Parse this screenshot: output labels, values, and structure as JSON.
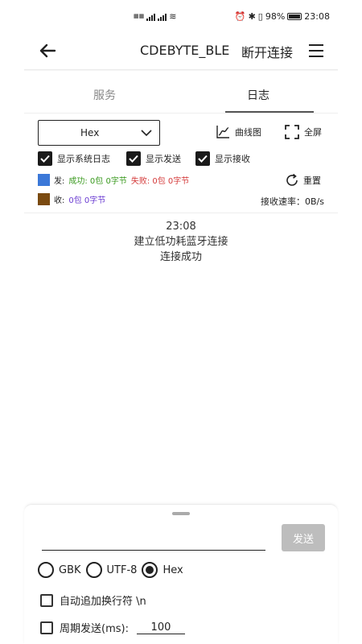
{
  "status_bar": {
    "battery_text": "98%",
    "time": "23:08"
  },
  "title_bar": {
    "title": "CDEBYTE_BLE",
    "disconnect_label": "断开连接"
  },
  "tabs": [
    {
      "label": "服务",
      "active": false
    },
    {
      "label": "日志",
      "active": true
    }
  ],
  "controls": {
    "encoding_select": "Hex",
    "chart_label": "曲线图",
    "fullscreen_label": "全屏"
  },
  "checkboxes": [
    {
      "label": "显示系统日志",
      "checked": true
    },
    {
      "label": "显示发送",
      "checked": true
    },
    {
      "label": "显示接收",
      "checked": true
    }
  ],
  "stats": {
    "send_prefix": "发:",
    "send_success": "成功: 0包 0字节",
    "send_fail": "失败: 0包 0字节",
    "send_color": "#3b78d8",
    "recv_prefix": "收:",
    "recv_value": "0包 0字节",
    "recv_color": "#7a4a10",
    "reset_label": "重置",
    "rate": "接收速率：0B/s"
  },
  "log": {
    "time": "23:08",
    "lines": [
      "建立低功耗蓝牙连接",
      "连接成功"
    ]
  },
  "send_panel": {
    "input_value": "",
    "send_button": "发送",
    "encodings": [
      {
        "label": "GBK",
        "checked": false
      },
      {
        "label": "UTF-8",
        "checked": false
      },
      {
        "label": "Hex",
        "checked": true
      }
    ],
    "auto_newline_label": "自动追加换行符 \\n",
    "periodic_label": "周期发送(ms):",
    "periodic_value": "100"
  }
}
